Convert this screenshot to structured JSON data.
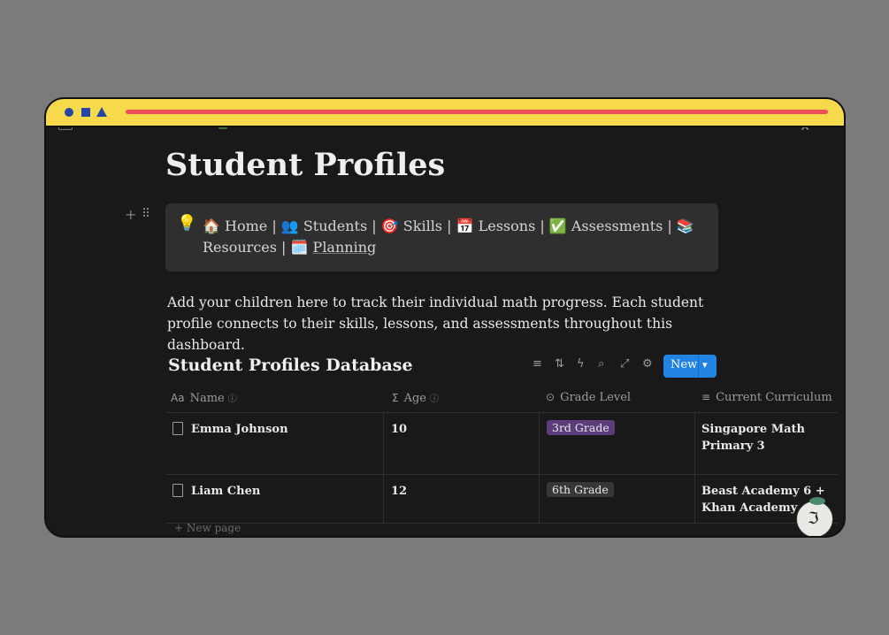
{
  "page": {
    "title": "Student Profiles",
    "callout": {
      "icon": "💡",
      "links": [
        {
          "emoji": "🏠",
          "label": "Home"
        },
        {
          "emoji": "👥",
          "label": "Students"
        },
        {
          "emoji": "🎯",
          "label": "Skills"
        },
        {
          "emoji": "📅",
          "label": "Lessons"
        },
        {
          "emoji": "✅",
          "label": "Assessments"
        },
        {
          "emoji": "📚",
          "label": "Resources"
        },
        {
          "emoji": "🗓️",
          "label": "Planning"
        }
      ],
      "separator": "|"
    },
    "description": "Add your children here to track their individual math progress. Each student profile connects to their skills, lessons, and assessments throughout this dashboard."
  },
  "database": {
    "title": "Student Profiles Database",
    "toolbar": {
      "icons": [
        "filter-icon",
        "sort-icon",
        "automation-icon",
        "search-icon",
        "expand-icon",
        "settings-icon"
      ],
      "new_label": "New"
    },
    "columns": [
      {
        "icon": "Aa",
        "label": "Name",
        "info": "ⓘ"
      },
      {
        "icon": "Σ",
        "label": "Age",
        "info": "ⓘ"
      },
      {
        "icon": "⊙",
        "label": "Grade Level"
      },
      {
        "icon": "≡",
        "label": "Current Curriculum"
      }
    ],
    "rows": [
      {
        "name": "Emma Johnson",
        "age": "10",
        "grade": "3rd Grade",
        "grade_color": "#5a3d7a",
        "curriculum": "Singapore Math Primary 3"
      },
      {
        "name": "Liam Chen",
        "age": "12",
        "grade": "6th Grade",
        "grade_color": "#373737",
        "curriculum": "Beast Academy 6 + Khan Academy"
      }
    ],
    "new_page_label": "New page"
  },
  "colors": {
    "titlebar": "#f7d94c",
    "accent_bar": "#ef4d5a",
    "shapes": "#2546a6",
    "background": "#191919",
    "new_button": "#2383e2"
  }
}
